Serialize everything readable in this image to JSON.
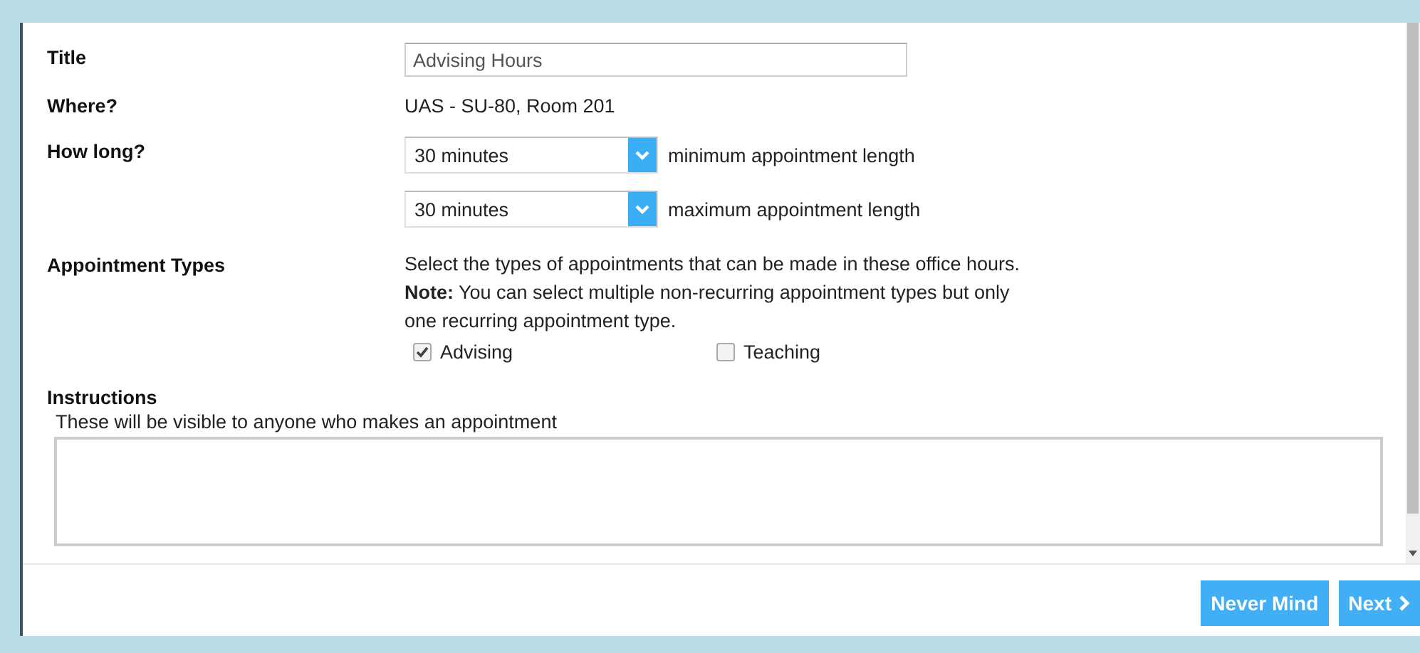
{
  "form": {
    "title_label": "Title",
    "title_value": "Advising Hours",
    "where_label": "Where?",
    "where_value": "UAS - SU-80, Room 201",
    "length_label": "How long?",
    "lengths": [
      {
        "value": "30 minutes",
        "caption": "minimum appointment length"
      },
      {
        "value": "30 minutes",
        "caption": "maximum appointment length"
      }
    ],
    "types_label": "Appointment Types",
    "types_description": "Select the types of appointments that can be made in these office hours.",
    "types_note": "**Note:** You can select multiple non-recurring appointment types but only one recurring appointment type.",
    "types": [
      {
        "label": "Advising",
        "checked": true
      },
      {
        "label": "Teaching",
        "checked": false
      }
    ],
    "instructions_label": "Instructions",
    "instructions_hint": "These will be visible to anyone who makes an appointment"
  },
  "buttons": [
    {
      "label": "Never Mind",
      "kind": "plain"
    },
    {
      "label": "Next",
      "kind": "next"
    }
  ]
}
